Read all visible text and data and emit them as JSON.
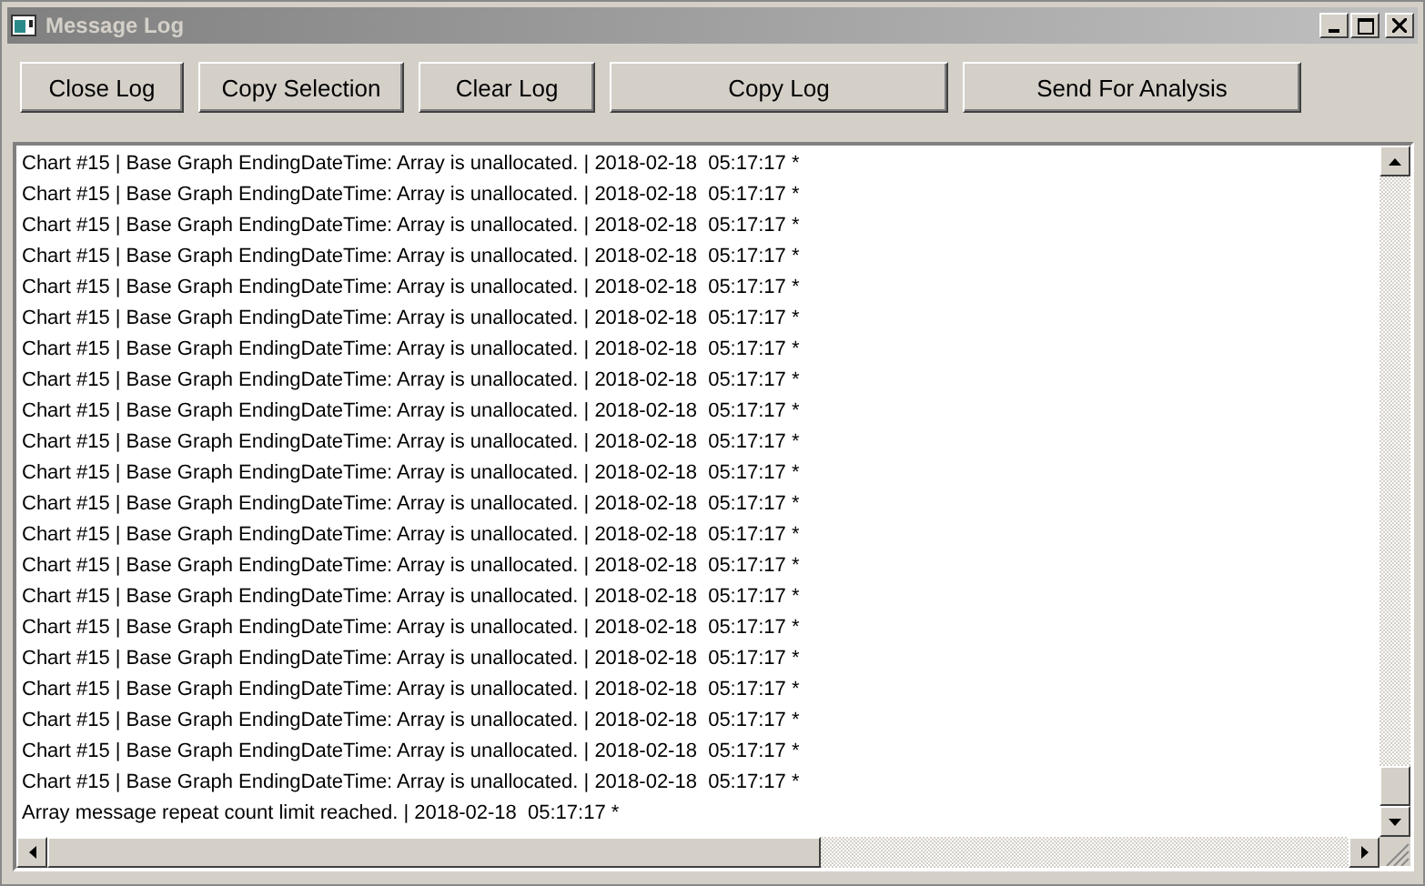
{
  "window": {
    "title": "Message Log"
  },
  "buttons": [
    "Close Log",
    "Copy Selection",
    "Clear Log",
    "Copy Log",
    "Send For Analysis"
  ],
  "log_lines": [
    "Chart #15 | Base Graph EndingDateTime: Array is unallocated. | 2018-02-18  05:17:17 *",
    "Chart #15 | Base Graph EndingDateTime: Array is unallocated. | 2018-02-18  05:17:17 *",
    "Chart #15 | Base Graph EndingDateTime: Array is unallocated. | 2018-02-18  05:17:17 *",
    "Chart #15 | Base Graph EndingDateTime: Array is unallocated. | 2018-02-18  05:17:17 *",
    "Chart #15 | Base Graph EndingDateTime: Array is unallocated. | 2018-02-18  05:17:17 *",
    "Chart #15 | Base Graph EndingDateTime: Array is unallocated. | 2018-02-18  05:17:17 *",
    "Chart #15 | Base Graph EndingDateTime: Array is unallocated. | 2018-02-18  05:17:17 *",
    "Chart #15 | Base Graph EndingDateTime: Array is unallocated. | 2018-02-18  05:17:17 *",
    "Chart #15 | Base Graph EndingDateTime: Array is unallocated. | 2018-02-18  05:17:17 *",
    "Chart #15 | Base Graph EndingDateTime: Array is unallocated. | 2018-02-18  05:17:17 *",
    "Chart #15 | Base Graph EndingDateTime: Array is unallocated. | 2018-02-18  05:17:17 *",
    "Chart #15 | Base Graph EndingDateTime: Array is unallocated. | 2018-02-18  05:17:17 *",
    "Chart #15 | Base Graph EndingDateTime: Array is unallocated. | 2018-02-18  05:17:17 *",
    "Chart #15 | Base Graph EndingDateTime: Array is unallocated. | 2018-02-18  05:17:17 *",
    "Chart #15 | Base Graph EndingDateTime: Array is unallocated. | 2018-02-18  05:17:17 *",
    "Chart #15 | Base Graph EndingDateTime: Array is unallocated. | 2018-02-18  05:17:17 *",
    "Chart #15 | Base Graph EndingDateTime: Array is unallocated. | 2018-02-18  05:17:17 *",
    "Chart #15 | Base Graph EndingDateTime: Array is unallocated. | 2018-02-18  05:17:17 *",
    "Chart #15 | Base Graph EndingDateTime: Array is unallocated. | 2018-02-18  05:17:17 *",
    "Chart #15 | Base Graph EndingDateTime: Array is unallocated. | 2018-02-18  05:17:17 *",
    "Chart #15 | Base Graph EndingDateTime: Array is unallocated. | 2018-02-18  05:17:17 *",
    "Array message repeat count limit reached. | 2018-02-18  05:17:17 *"
  ]
}
